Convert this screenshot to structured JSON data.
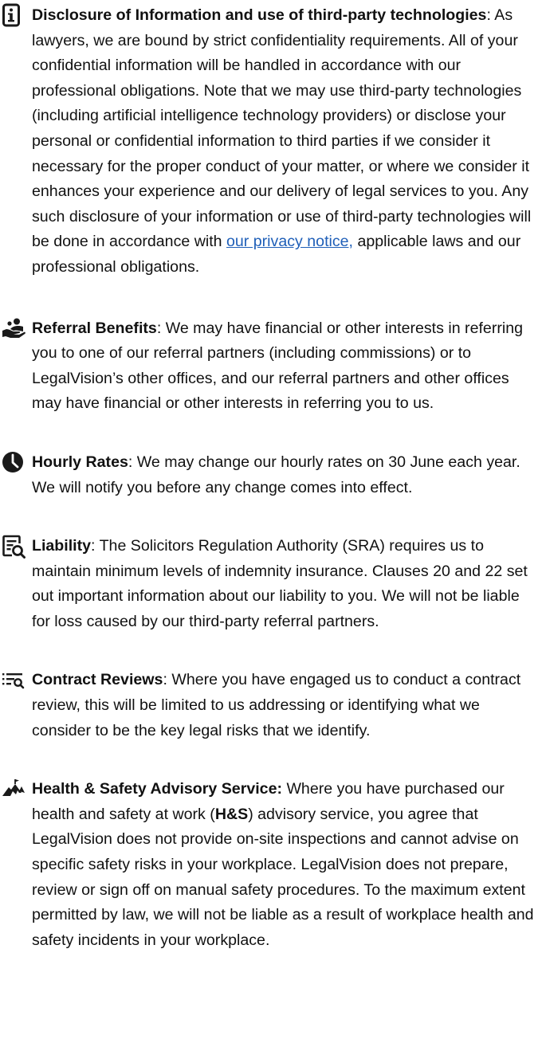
{
  "sections": {
    "disclosure": {
      "icon": "info-icon",
      "heading": "Disclosure of Information and use of third-party technologies",
      "body": ": As lawyers, we are bound by strict confidentiality requirements. All of your confidential information will be handled in accordance with our professional obligations. Note that we may use third-party technologies (including artificial intelligence technology providers) or disclose your personal or confidential information to third parties if we consider it necessary for the proper conduct of your matter, or where we consider it enhances your experience and our delivery of legal services to you. Any such disclosure of your information or use of third-party technologies will be done in accordance with ",
      "link_text": "our privacy notice,",
      "body_after": " applicable laws and our professional obligations."
    },
    "referral": {
      "icon": "hand-person-icon",
      "heading": "Referral Benefits",
      "body": ": We may have financial or other interests in referring you to one of our referral partners (including commissions) or to LegalVision’s other offices, and our referral partners and other offices may have financial or other interests in referring you to us."
    },
    "hourly": {
      "icon": "clock-icon",
      "heading": "Hourly Rates",
      "body": ": We may change our hourly rates on 30 June each year. We will notify you before any change comes into effect."
    },
    "liability": {
      "icon": "document-search-icon",
      "heading": "Liability",
      "body": ": The Solicitors Regulation Authority (SRA) requires us to maintain minimum levels of indemnity insurance. Clauses 20 and 22 set out important information about our liability to you. We will not be liable for loss caused by our third-party referral partners."
    },
    "contract": {
      "icon": "list-search-icon",
      "heading": "Contract Reviews",
      "body": ": Where you have engaged us to conduct a contract review, this will be limited to us addressing or identifying what we consider to be the key legal risks that we identify."
    },
    "hs": {
      "icon": "mountain-flag-icon",
      "heading": "Health & Safety Advisory Service:",
      "body_pre": " Where you have purchased our health and safety at work (",
      "abbr": "H&S",
      "body": ") advisory service, you agree that LegalVision does not provide on-site inspections and cannot advise on specific safety risks in your workplace. LegalVision does not prepare, review or sign off on manual safety procedures. To the maximum extent permitted by law, we will not be liable as a result of workplace health and safety incidents in your workplace."
    }
  },
  "colors": {
    "text": "#111111",
    "link": "#1f5fb8",
    "icon": "#1a1a1a"
  }
}
